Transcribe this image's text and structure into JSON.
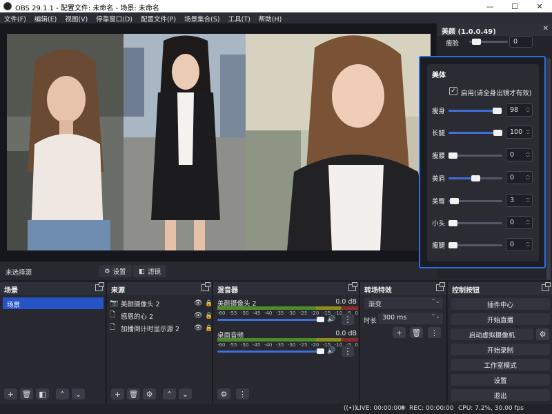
{
  "window": {
    "title": "OBS 29.1.1 - 配置文件: 未命名 - 场景: 未命名",
    "controls": [
      "—",
      "☐",
      "✕"
    ]
  },
  "menu": [
    "文件(F)",
    "编辑(E)",
    "视图(V)",
    "停靠窗口(D)",
    "配置文件(P)",
    "场景集合(S)",
    "工具(T)",
    "帮助(H)"
  ],
  "source_toolbar": {
    "no_source": "未选择源",
    "settings_label": "设置",
    "filters_label": "滤镜"
  },
  "scenes": {
    "title": "场景",
    "items": [
      "场景"
    ]
  },
  "sources": {
    "title": "来源",
    "items": [
      {
        "icon": "camera-icon",
        "name": "美颜摄像头 2"
      },
      {
        "icon": "file-icon",
        "name": "感恩的心 2"
      },
      {
        "icon": "file-icon",
        "name": "加播倒计时显示源 2"
      }
    ]
  },
  "mixer": {
    "title": "混音器",
    "ticks": [
      "-60",
      "-55",
      "-50",
      "-45",
      "-40",
      "-35",
      "-30",
      "-25",
      "-20",
      "-15",
      "-10",
      "-5",
      "0"
    ],
    "channels": [
      {
        "name": "美颜摄像头 2",
        "db": "0.0 dB",
        "level": 0.95
      },
      {
        "name": "桌面音频",
        "db": "0.0 dB",
        "level": 0.95
      }
    ]
  },
  "transitions": {
    "title": "转场特效",
    "selected": "渐变",
    "duration_label": "时长",
    "duration_value": "300 ms"
  },
  "controls": {
    "title": "控制按钮",
    "plugin_center": "插件中心",
    "start_stream": "开始直播",
    "virtual_cam": "启动虚拟摄像机",
    "start_record": "开始录制",
    "studio_mode": "工作室模式",
    "settings": "设置",
    "exit": "退出"
  },
  "status": {
    "live": "LIVE: 00:00:00",
    "rec": "REC: 00:00:00",
    "cpu": "CPU: 7.2%, 30.00 fps"
  },
  "beauty": {
    "title": "美颜 (1.0.0.49)",
    "top_label": "瘦脸",
    "top_value": "0",
    "section": "美体",
    "enable_label": "启用(请全身出镜才有效)",
    "enabled": true,
    "rows": [
      {
        "label": "瘦身",
        "value": "98",
        "level": 0.98
      },
      {
        "label": "长腿",
        "value": "100",
        "level": 1.0
      },
      {
        "label": "瘦腰",
        "value": "0",
        "level": 0.0
      },
      {
        "label": "美肩",
        "value": "0",
        "level": 0.5
      },
      {
        "label": "美臀",
        "value": "3",
        "level": 0.03
      },
      {
        "label": "小头",
        "value": "0",
        "level": 0.0
      },
      {
        "label": "瘦腿",
        "value": "0",
        "level": 0.0
      }
    ]
  }
}
